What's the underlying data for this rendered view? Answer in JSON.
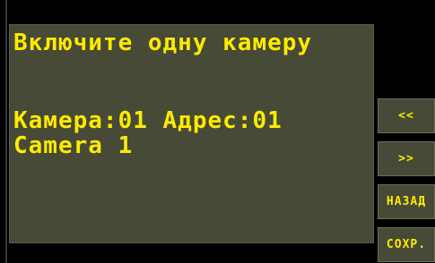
{
  "screen": {
    "line1": "Включите одну камеру",
    "line2": "Камера:01 Адрес:01",
    "line3": "Camera 1"
  },
  "buttons": {
    "prev": "<<",
    "next": ">>",
    "back": "НАЗАД",
    "save": "СОХР."
  },
  "colors": {
    "text": "#ffea00",
    "panel": "#464a37",
    "background": "#000000"
  }
}
